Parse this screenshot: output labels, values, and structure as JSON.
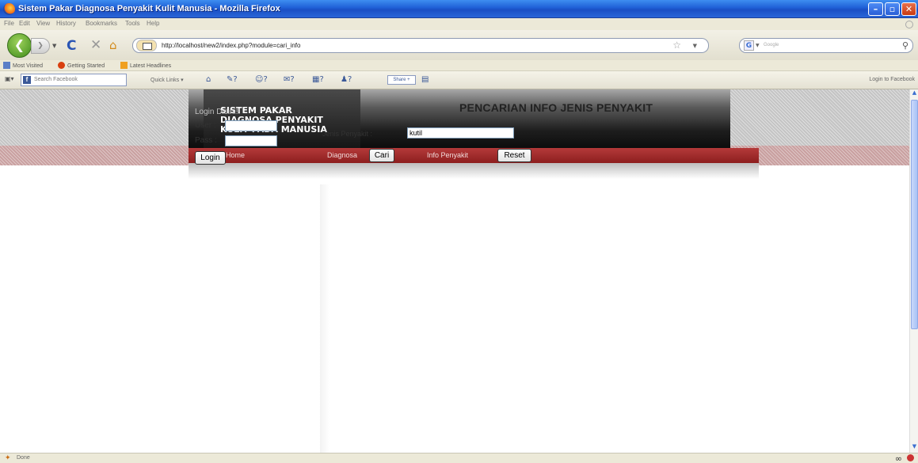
{
  "window": {
    "title": "Sistem Pakar Diagnosa Penyakit Kulit Manusia - Mozilla Firefox"
  },
  "menu": [
    "File",
    "Edit",
    "View",
    "History",
    "Bookmarks",
    "Tools",
    "Help"
  ],
  "nav": {
    "url": "http://localhost/new2/index.php?module=cari_info",
    "search_placeholder": "Google"
  },
  "bookmarks": [
    "Most Visited",
    "Getting Started",
    "Latest Headlines"
  ],
  "fbtoolbar": {
    "search_placeholder": "Search Facebook",
    "quick_links": "Quick Links",
    "share": "Share",
    "login": "Login to Facebook",
    "counts": [
      "?",
      "?",
      "?",
      "?",
      "?"
    ]
  },
  "site": {
    "logo_line1": "SISTEM PAKAR",
    "logo_line2": "DIAGNOSA PENYAKIT",
    "logo_line3": "KULIT PADA MANUSIA",
    "nav": [
      "Home",
      "Diagnosa",
      "Info Penyakit"
    ]
  },
  "login": {
    "title": "Login Disini!!",
    "user_label": "User :",
    "pass_label": "Pass :",
    "button": "Login"
  },
  "search": {
    "title": "PENCARIAN INFO JENIS PENYAKIT",
    "field_label": "Jenis Penyakit :",
    "field_value": "kutil",
    "search_button": "Cari",
    "reset_button": "Reset"
  },
  "status": {
    "text": "Done"
  },
  "colors": {
    "menu_red": "#a02b2b",
    "header_black": "#111111",
    "titlebar_blue": "#1f5fd6"
  }
}
